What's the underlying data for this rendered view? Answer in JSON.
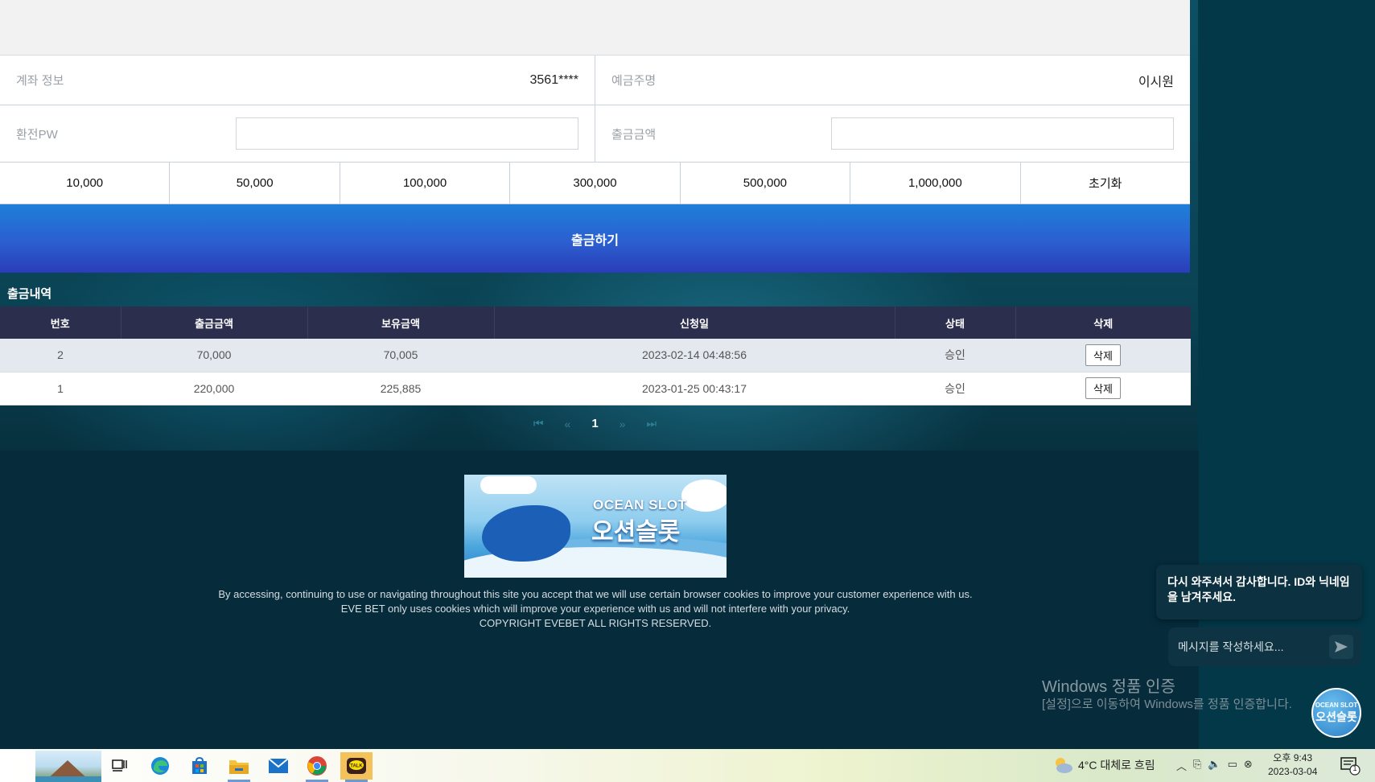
{
  "account": {
    "info_label": "계좌 정보",
    "info_value": "3561****",
    "holder_label": "예금주명",
    "holder_value": "이시원"
  },
  "form": {
    "pw_label": "환전PW",
    "pw_value": "",
    "amount_label": "출금금액",
    "amount_value": ""
  },
  "amount_buttons": [
    "10,000",
    "50,000",
    "100,000",
    "300,000",
    "500,000",
    "1,000,000",
    "초기화"
  ],
  "withdraw_button": "출금하기",
  "history": {
    "title": "출금내역",
    "columns": [
      "번호",
      "출금금액",
      "보유금액",
      "신청일",
      "상태",
      "삭제"
    ],
    "rows": [
      {
        "no": "2",
        "amount": "70,000",
        "balance": "70,005",
        "date": "2023-02-14 04:48:56",
        "status": "승인",
        "delete": "삭제"
      },
      {
        "no": "1",
        "amount": "220,000",
        "balance": "225,885",
        "date": "2023-01-25 00:43:17",
        "status": "승인",
        "delete": "삭제"
      }
    ]
  },
  "pagination": {
    "current_page": "1"
  },
  "logo": {
    "en": "OCEAN SLOT",
    "ko": "오션슬롯"
  },
  "footer": {
    "line1": "By accessing, continuing to use or navigating throughout this site you accept that we will use certain browser cookies to improve your customer experience with us.",
    "line2": "EVE BET only uses cookies which will improve your experience with us and will not interfere with your privacy.",
    "line3": "COPYRIGHT EVEBET ALL RIGHTS RESERVED."
  },
  "watermark": {
    "title": "Windows 정품 인증",
    "subtitle": "[설정]으로 이동하여 Windows를 정품 인증합니다."
  },
  "chat": {
    "message": "다시 와주셔서 감사합니다. ID와 닉네임을 남겨주세요.",
    "placeholder": "메시지를 작성하세요...",
    "avatar_en": "OCEAN SLOT",
    "avatar_ko": "오션슬롯"
  },
  "taskbar": {
    "weather": "4°C  대체로 흐림",
    "time": "오후 9:43",
    "date": "2023-03-04",
    "notification_count": "1",
    "icons": [
      "task-view-icon",
      "edge-icon",
      "store-icon",
      "file-explorer-icon",
      "mail-icon",
      "chrome-icon",
      "kakaotalk-icon"
    ]
  },
  "colors": {
    "withdraw_gradient_top": "#1f7fd9",
    "withdraw_gradient_bottom": "#2a3db8",
    "table_header": "#2c2e4e",
    "footer_bg": "#062b3b"
  }
}
